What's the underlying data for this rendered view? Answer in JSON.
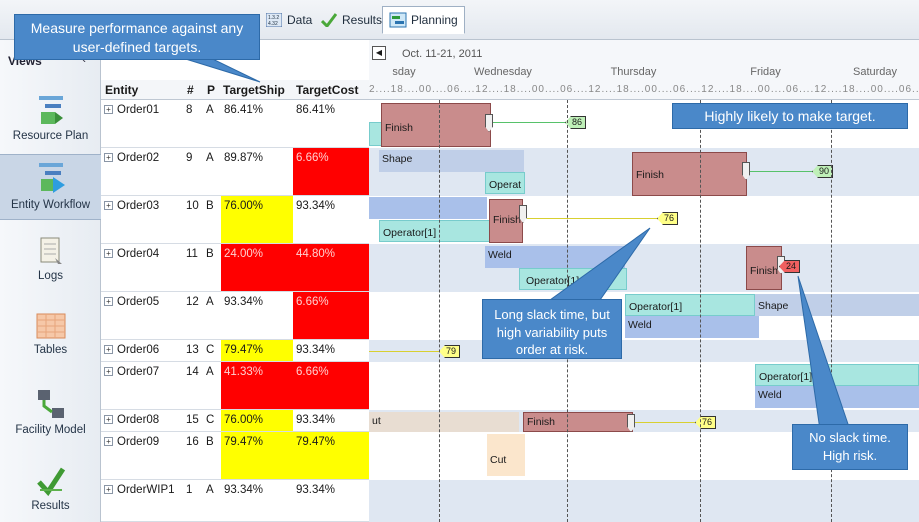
{
  "tabs": [
    {
      "label": "Data",
      "icon": "data-table-icon"
    },
    {
      "label": "Results",
      "icon": "results-check-icon"
    },
    {
      "label": "Planning",
      "icon": "planning-chart-icon"
    }
  ],
  "sidebar": {
    "title": "Views",
    "collapse_glyph": "‹",
    "items": [
      {
        "label": "Resource Plan",
        "icon": "resource-plan-icon"
      },
      {
        "label": "Entity Workflow",
        "icon": "entity-workflow-icon"
      },
      {
        "label": "Logs",
        "icon": "logs-icon"
      },
      {
        "label": "Tables",
        "icon": "tables-icon"
      },
      {
        "label": "Facility Model",
        "icon": "facility-model-icon"
      },
      {
        "label": "Results",
        "icon": "results-icon"
      }
    ]
  },
  "grid": {
    "collapse_arrows": "«",
    "headers": {
      "entity": "Entity",
      "num": "#",
      "p": "P",
      "target_ship": "TargetShip",
      "target_cost": "TargetCost"
    },
    "rows": [
      {
        "entity": "Order01",
        "num": "8",
        "p": "A",
        "ship": "86.41%",
        "cost": "86.41%",
        "ship_color": "",
        "cost_color": ""
      },
      {
        "entity": "Order02",
        "num": "9",
        "p": "A",
        "ship": "89.87%",
        "cost": "6.66%",
        "ship_color": "",
        "cost_color": "red"
      },
      {
        "entity": "Order03",
        "num": "10",
        "p": "B",
        "ship": "76.00%",
        "cost": "93.34%",
        "ship_color": "yellow",
        "cost_color": ""
      },
      {
        "entity": "Order04",
        "num": "11",
        "p": "B",
        "ship": "24.00%",
        "cost": "44.80%",
        "ship_color": "red",
        "cost_color": "red"
      },
      {
        "entity": "Order05",
        "num": "12",
        "p": "A",
        "ship": "93.34%",
        "cost": "6.66%",
        "ship_color": "",
        "cost_color": "red"
      },
      {
        "entity": "Order06",
        "num": "13",
        "p": "C",
        "ship": "79.47%",
        "cost": "93.34%",
        "ship_color": "yellow",
        "cost_color": ""
      },
      {
        "entity": "Order07",
        "num": "14",
        "p": "A",
        "ship": "41.33%",
        "cost": "6.66%",
        "ship_color": "red",
        "cost_color": "red"
      },
      {
        "entity": "Order08",
        "num": "15",
        "p": "C",
        "ship": "76.00%",
        "cost": "93.34%",
        "ship_color": "yellow",
        "cost_color": ""
      },
      {
        "entity": "Order09",
        "num": "16",
        "p": "B",
        "ship": "79.47%",
        "cost": "79.47%",
        "ship_color": "yellow",
        "cost_color": "yellow"
      },
      {
        "entity": "OrderWIP1",
        "num": "1",
        "p": "A",
        "ship": "93.34%",
        "cost": "93.34%",
        "ship_color": "",
        "cost_color": ""
      }
    ]
  },
  "gantt": {
    "date_range": "Oct. 11-21, 2011",
    "days": [
      "sday",
      "Wednesday",
      "Thursday",
      "Friday",
      "Saturday"
    ],
    "hours": "2....18....00....06....12....18....00....06....12....18....00....06....12....18....00....06....12....18....00....06....12....",
    "labels": {
      "finish": "Finish",
      "shape": "Shape",
      "operat": "Operat",
      "operator1": "Operator[1]",
      "weld": "Weld",
      "cut": "Cut",
      "ut": "ut"
    },
    "flags": {
      "o1": "86",
      "o2": "90",
      "o3": "76",
      "o4": "24",
      "o6": "79",
      "o8": "76"
    }
  },
  "callouts": {
    "targets": "Measure performance against any user-defined targets.",
    "likely": "Highly likely to make target.",
    "slack": "Long slack time, but high variability puts order at risk.",
    "no_slack": "No slack time. High risk."
  },
  "colors": {
    "red": "#ff0000",
    "yellow": "#ffff00",
    "callout": "#4a88c9"
  }
}
